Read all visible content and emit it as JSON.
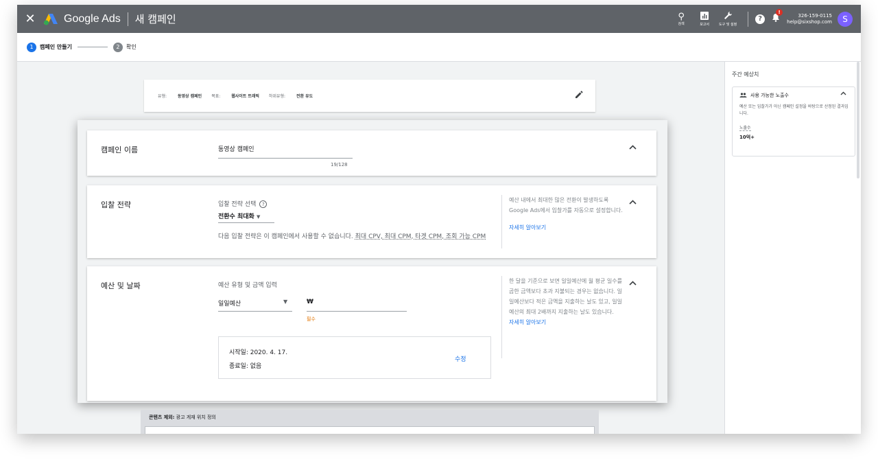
{
  "header": {
    "brand": "Google Ads",
    "page_title": "새 캠페인",
    "tools": [
      {
        "icon": "search-icon",
        "label": "검색"
      },
      {
        "icon": "reports-icon",
        "label": "보고서"
      },
      {
        "icon": "wrench-icon",
        "label": "도구 및 설정"
      }
    ],
    "notification_badge": "!",
    "account_id": "326-159-0115",
    "account_email": "help@sixshop.com",
    "avatar_letter": "S"
  },
  "stepper": {
    "steps": [
      {
        "num": "1",
        "label": "캠페인 만들기"
      },
      {
        "num": "2",
        "label": "확인"
      }
    ]
  },
  "summary": {
    "type_label": "유형:",
    "type_value": "동영상 캠페인",
    "goal_label": "목표:",
    "goal_value": "웹사이트 트래픽",
    "subtype_label": "하위유형:",
    "subtype_value": "전환 유도"
  },
  "campaign_name": {
    "title": "캠페인 이름",
    "value": "동영상 캠페인",
    "count": "19/128"
  },
  "bidding": {
    "title": "입찰 전략",
    "select_label": "입찰 전략 선택",
    "selected": "전환수 최대화",
    "note_prefix": "다음 입찰 전략은 이 캠페인에서 사용할 수 없습니다.",
    "note_items": "최대 CPV, 최대 CPM, 타겟 CPM, 조회 가능 CPM",
    "help": "예산 내에서 최대한 많은 전환이 발생하도록 Google Ads에서 입찰가를 자동으로 설정합니다.",
    "learn_more": "자세히 알아보기"
  },
  "budget": {
    "title": "예산 및 날짜",
    "label": "예산 유형 및 금액 입력",
    "type": "일일예산",
    "currency": "₩",
    "required": "필수",
    "start": "시작일: 2020. 4. 17.",
    "end": "종료일: 없음",
    "edit": "수정",
    "help": "한 달을 기준으로 보면 일일예산에 월 평균 일수를 곱한 금액보다 초과 지불되는 경우는 없습니다. 일일예산보다 적은 금액을 지출하는 날도 있고, 일일예산의 최대 2배까지 지출하는 날도 있습니다.",
    "learn_more": "자세히 알아보기"
  },
  "exclusion": {
    "title_bold": "콘텐츠 제외:",
    "title_rest": " 광고 게재 위치 정의"
  },
  "right_panel": {
    "title": "주간 예상치",
    "card_title": "사용 가능한 노출수",
    "card_desc": "예산 또는 입찰가가 아닌 캠페인 설정을 바탕으로 산정된 결과입니다.",
    "metric_label": "노출수",
    "metric_value": "10억+"
  }
}
